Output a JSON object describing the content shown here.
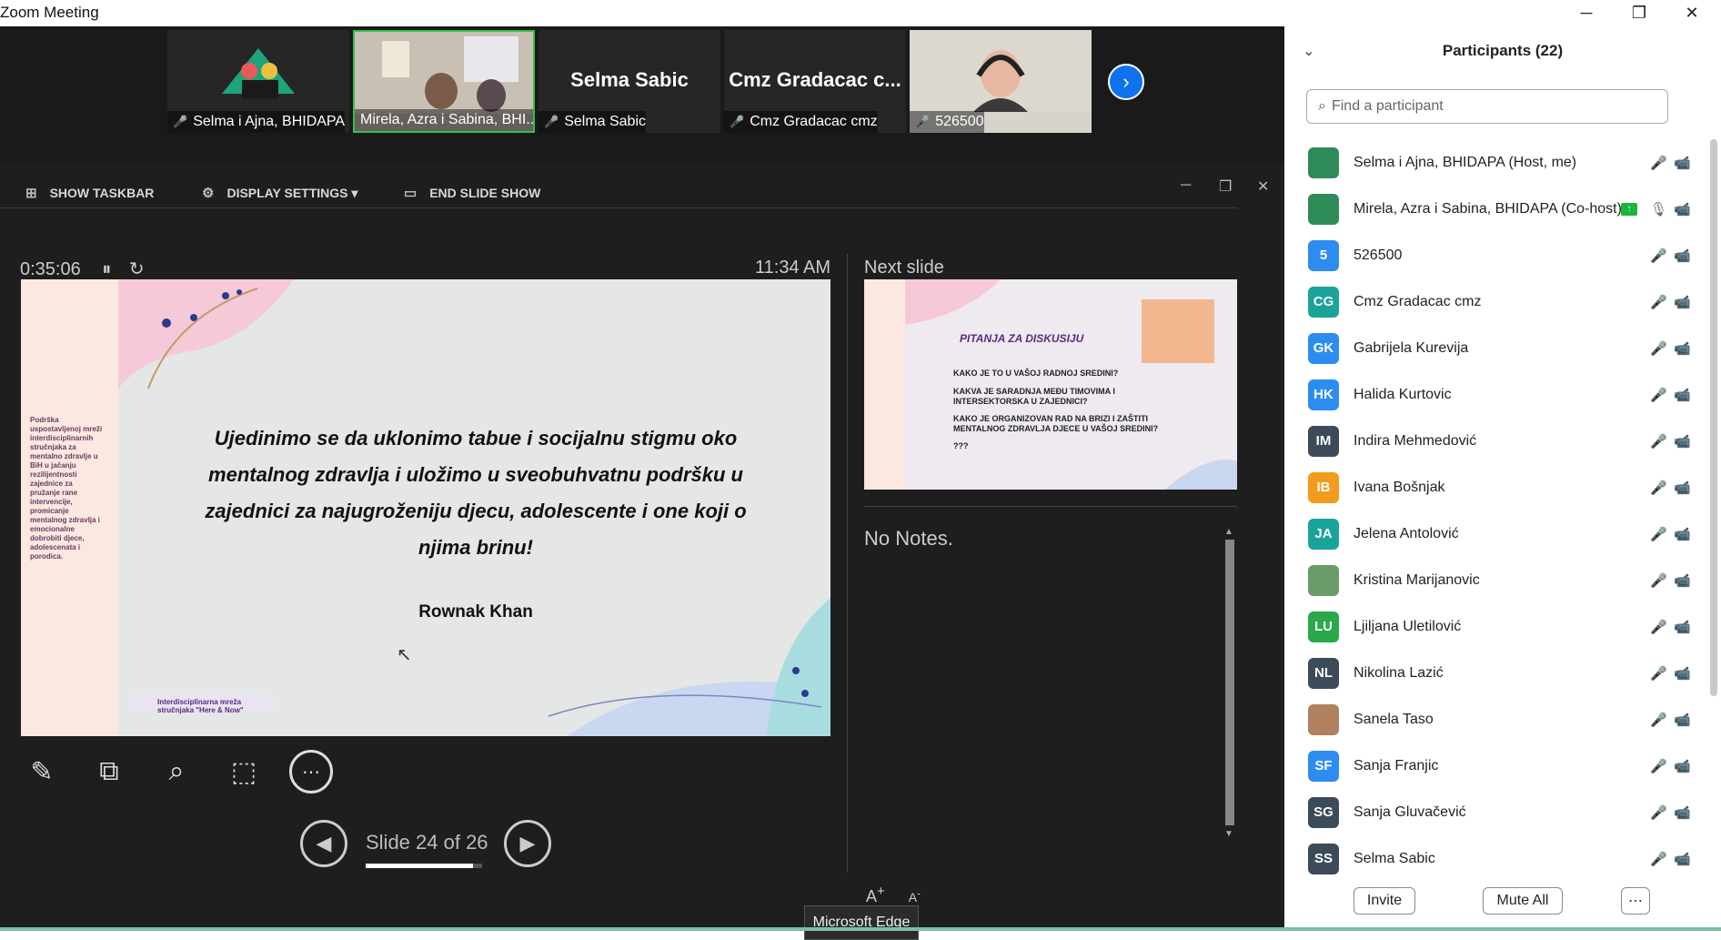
{
  "window": {
    "title": "Zoom Meeting"
  },
  "video_strip": {
    "tiles": [
      {
        "name": "Selma i Ajna, BHIDAPA",
        "big_label": ""
      },
      {
        "name": "Mirela, Azra i Sabina, BHI...",
        "big_label": ""
      },
      {
        "name": "Selma Sabic",
        "big_label": "Selma Sabic"
      },
      {
        "name": "Cmz Gradacac cmz",
        "big_label": "Cmz Gradacac c..."
      },
      {
        "name": "526500",
        "big_label": ""
      }
    ]
  },
  "presenter": {
    "toolbar": {
      "show_taskbar": "SHOW TASKBAR",
      "display_settings": "DISPLAY SETTINGS ▾",
      "end_slide_show": "END SLIDE SHOW"
    },
    "elapsed": "0:35:06",
    "clock": "11:34 AM",
    "next_slide_label": "Next slide",
    "current_slide": {
      "quote": "Ujedinimo se da uklonimo tabue i socijalnu stigmu oko mentalnog zdravlja i uložimo u sveobuhvatnu podršku u zajednici za najugroženiju djecu, adolescente i one koji o njima brinu!",
      "author": "Rownak Khan",
      "side_text": "Podrška uspostavljenoj mreži interdisciplinarnih stručnjaka za mentalno zdravlje u BiH u jačanju rezilijentnosti zajednice za pružanje rane intervencije, promicanje mentalnog zdravlja i emocionalne dobrobiti djece, adolescenata i porodica.",
      "footer": "Interdisciplinarna mreža stručnjaka \"Here & Now\""
    },
    "next_slide": {
      "title": "PITANJA ZA DISKUSIJU",
      "items": [
        "KAKO JE TO U VAŠOJ RADNOJ SREDINI?",
        "KAKVA JE SARADNJA MEĐU TIMOVIMA I INTERSEKTORSKA U ZAJEDNICI?",
        "KAKO JE ORGANIZOVAN RAD NA BRIZI I ZAŠTITI MENTALNOG ZDRAVLJA DJECE U VAŠOJ SREDINI?",
        "???"
      ]
    },
    "notes": "No Notes.",
    "slide_counter": "Slide 24 of 26",
    "progress": 0.923,
    "tooltip": "Microsoft Edge"
  },
  "participants": {
    "header": "Participants (22)",
    "search_placeholder": "Find a participant",
    "list": [
      {
        "name": "Selma i Ajna, BHIDAPA (Host, me)",
        "initials": "",
        "color": "#2e8b57",
        "cam": "off"
      },
      {
        "name": "Mirela, Azra i Sabina, BHIDAPA (Co-host)",
        "initials": "",
        "color": "#2e8b57",
        "cam": "on"
      },
      {
        "name": "526500",
        "initials": "5",
        "color": "#2d8cf0",
        "cam": "on"
      },
      {
        "name": "Cmz Gradacac cmz",
        "initials": "CG",
        "color": "#1aa39a",
        "cam": "off"
      },
      {
        "name": "Gabrijela Kurevija",
        "initials": "GK",
        "color": "#2d8cf0",
        "cam": "off"
      },
      {
        "name": "Halida Kurtovic",
        "initials": "HK",
        "color": "#2d8cf0",
        "cam": "off"
      },
      {
        "name": "Indira Mehmedović",
        "initials": "IM",
        "color": "#3d4a5a",
        "cam": "off"
      },
      {
        "name": "Ivana Bošnjak",
        "initials": "IB",
        "color": "#f29b1d",
        "cam": "off"
      },
      {
        "name": "Jelena Antolović",
        "initials": "JA",
        "color": "#1aa39a",
        "cam": "off"
      },
      {
        "name": "Kristina Marijanovic",
        "initials": "",
        "color": "#6a9b6a",
        "cam": "on"
      },
      {
        "name": "Ljiljana Uletilović",
        "initials": "LU",
        "color": "#2aa84a",
        "cam": "off"
      },
      {
        "name": "Nikolina Lazić",
        "initials": "NL",
        "color": "#3d4a5a",
        "cam": "on"
      },
      {
        "name": "Sanela Taso",
        "initials": "",
        "color": "#b08060",
        "cam": "off"
      },
      {
        "name": "Sanja Franjic",
        "initials": "SF",
        "color": "#2d8cf0",
        "cam": "off"
      },
      {
        "name": "Sanja Gluvačević",
        "initials": "SG",
        "color": "#3d4a5a",
        "cam": "off"
      },
      {
        "name": "Selma Sabic",
        "initials": "SS",
        "color": "#3d4a5a",
        "cam": "off"
      }
    ],
    "invite_label": "Invite",
    "mute_all_label": "Mute All"
  }
}
